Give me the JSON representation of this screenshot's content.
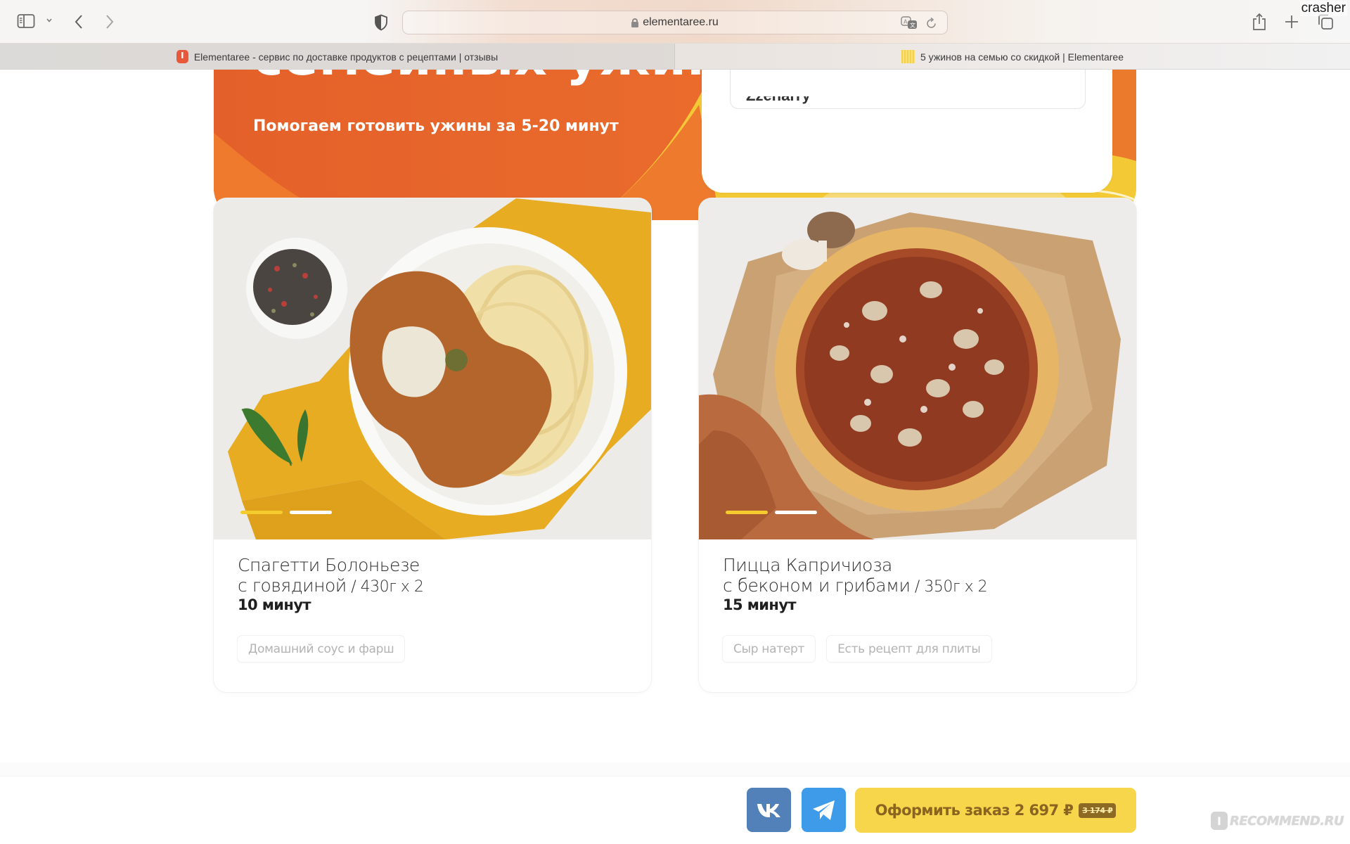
{
  "browser": {
    "url": "elementaree.ru",
    "user_label": "crasher",
    "tabs": [
      {
        "title": "Elementaree - сервис по доставке продуктов с рецептами | отзывы",
        "favicon": "irecommend-favicon",
        "active": true
      },
      {
        "title": "5 ужинов на семью со скидкой | Elementaree",
        "favicon": "elementaree-favicon",
        "active": false
      }
    ],
    "icons": {
      "sidebar": "sidebar-icon",
      "back": "chevron-left-icon",
      "forward": "chevron-right-icon",
      "privacy": "shield-icon",
      "translate": "translate-icon",
      "reload": "reload-icon",
      "share": "share-icon",
      "new_tab": "plus-icon",
      "tabs_overview": "tabs-icon"
    }
  },
  "hero": {
    "title_partial": "семейных ужинов",
    "subtitle": "Помогаем готовить ужины за 5-20 минут",
    "input_value_partial": "Zzenarry",
    "colors": {
      "orange": "#e4632a",
      "yellow": "#f5cd3e"
    }
  },
  "products": [
    {
      "title_line1": "Спагетти Болоньезе",
      "title_line2": "с говядиной",
      "weight": " / 430г х 2",
      "time": "10 минут",
      "tags": [
        "Домашний соус и фарш"
      ],
      "slides": {
        "count": 2,
        "active": 1
      }
    },
    {
      "title_line1": "Пицца Капричиоза",
      "title_line2": "с беконом и грибами",
      "weight": " / 350г х 2",
      "time": "15 минут",
      "tags": [
        "Сыр натерт",
        "Есть рецепт для плиты"
      ],
      "slides": {
        "count": 2,
        "active": 1
      }
    }
  ],
  "footer": {
    "vk_label": "VK",
    "telegram_label": "Telegram",
    "order_label": "Оформить заказ 2 697 ₽",
    "old_price": "3 174 ₽",
    "colors": {
      "order_bg": "#f8d64c",
      "order_text": "#8a6420",
      "vk": "#5181b8",
      "telegram": "#3d9bea"
    }
  },
  "watermark": {
    "badge": "I",
    "text": "RECOMMEND.RU"
  }
}
